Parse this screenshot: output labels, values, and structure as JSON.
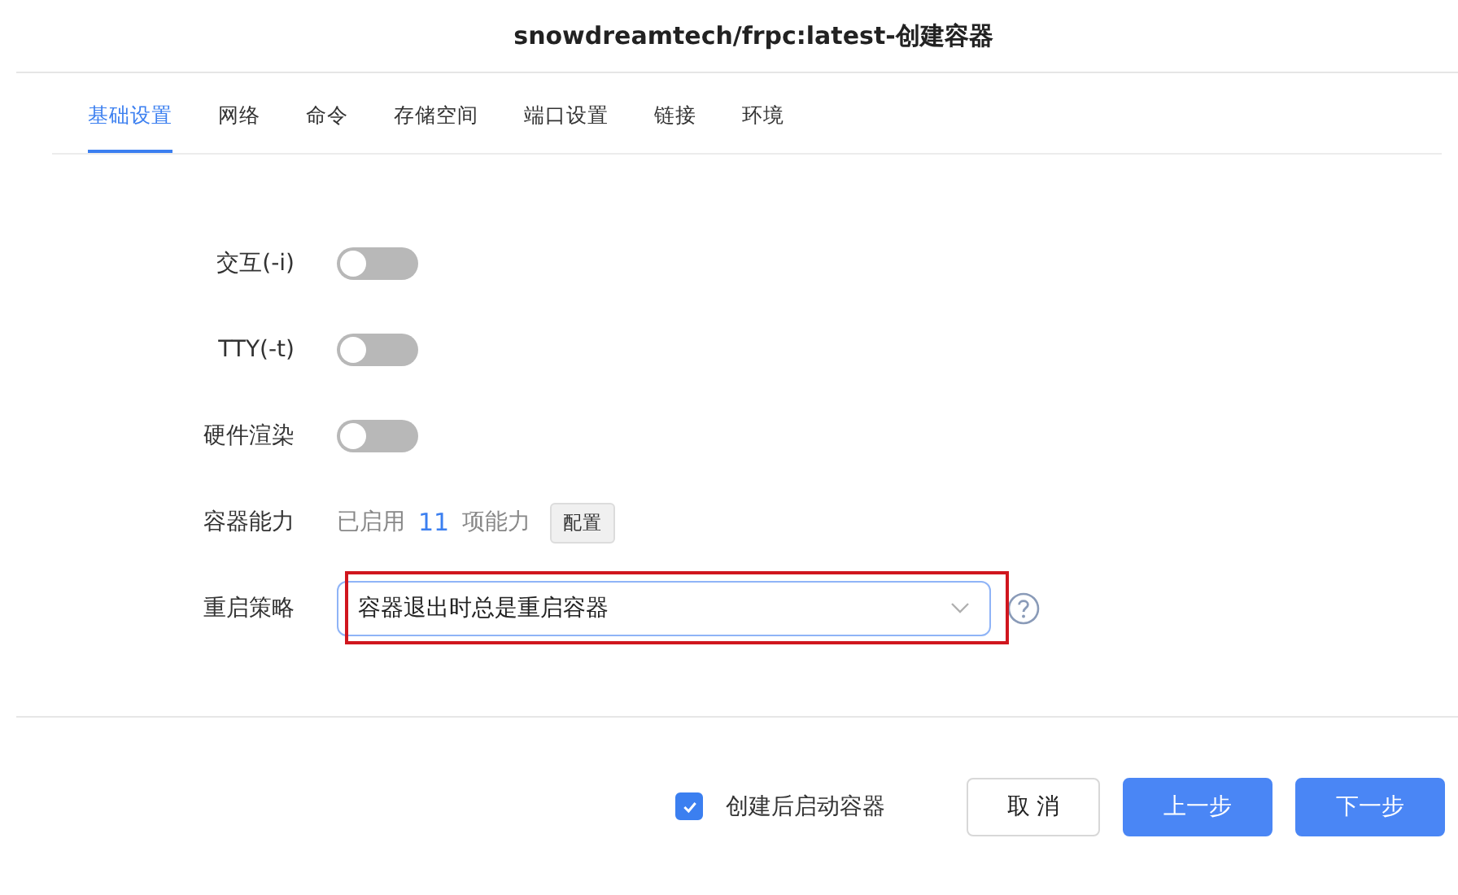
{
  "window": {
    "title": "snowdreamtech/frpc:latest-创建容器"
  },
  "tabs": [
    {
      "label": "基础设置",
      "selected": true
    },
    {
      "label": "网络",
      "selected": false
    },
    {
      "label": "命令",
      "selected": false
    },
    {
      "label": "存储空间",
      "selected": false
    },
    {
      "label": "端口设置",
      "selected": false
    },
    {
      "label": "链接",
      "selected": false
    },
    {
      "label": "环境",
      "selected": false
    }
  ],
  "fields": [
    {
      "kind": "toggle",
      "label": "交互(-i)",
      "on": false
    },
    {
      "kind": "toggle",
      "label": "TTY(-t)",
      "on": false
    },
    {
      "kind": "toggle",
      "label": "硬件渲染",
      "on": false
    },
    {
      "kind": "capabilities",
      "label": "容器能力",
      "prefix": "已启用",
      "count": "11",
      "suffix": "项能力",
      "button": "配置"
    },
    {
      "kind": "select",
      "label": "重启策略",
      "value": "容器退出时总是重启容器",
      "highlighted": true
    }
  ],
  "footer": {
    "start_after_create": {
      "label": "创建后启动容器",
      "checked": true
    },
    "buttons": [
      {
        "label": "取 消",
        "kind": "secondary"
      },
      {
        "label": "上一步",
        "kind": "primary"
      },
      {
        "label": "下一步",
        "kind": "primary"
      }
    ]
  }
}
